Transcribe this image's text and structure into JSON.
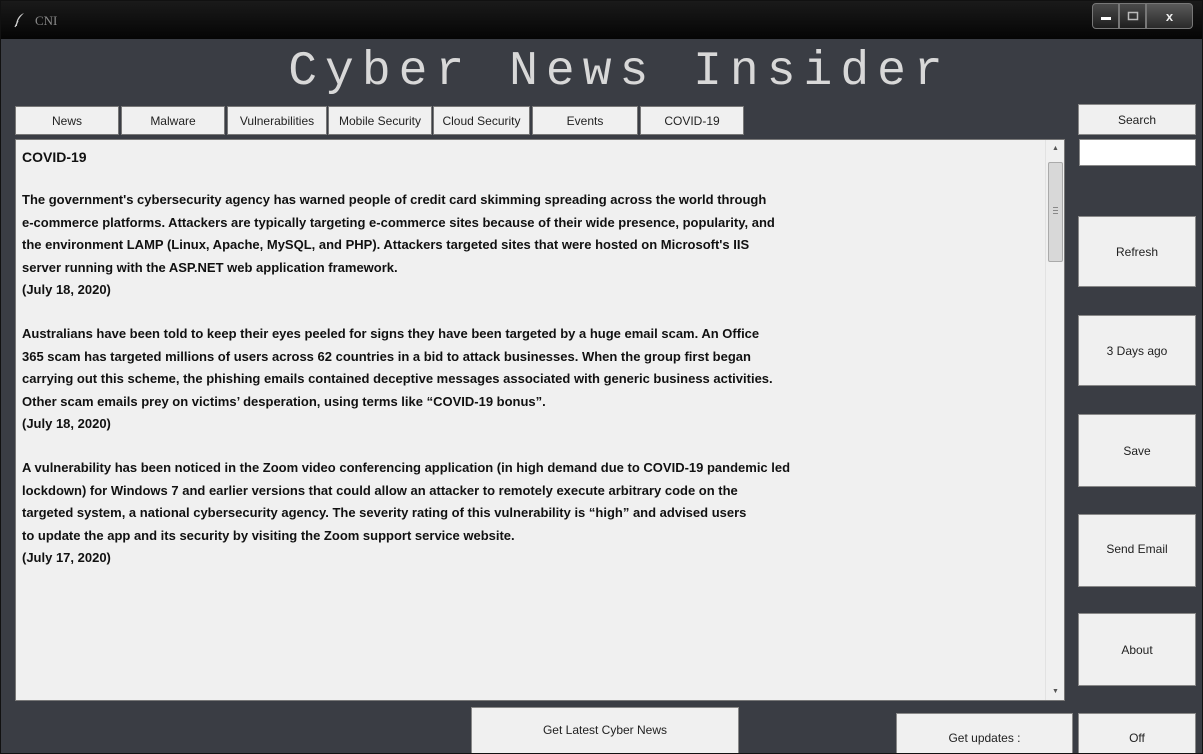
{
  "window": {
    "title": "CNI",
    "icon": "feather-icon",
    "controls": {
      "minimize": "minimize-icon",
      "maximize": "maximize-icon",
      "close_label": "x"
    }
  },
  "app": {
    "title": "Cyber News Insider"
  },
  "tabs": [
    {
      "label": "News"
    },
    {
      "label": "Malware"
    },
    {
      "label": "Vulnerabilities"
    },
    {
      "label": "Mobile Security"
    },
    {
      "label": "Cloud Security"
    },
    {
      "label": "Events"
    },
    {
      "label": "COVID-19"
    }
  ],
  "content": {
    "heading": "COVID-19",
    "articles": [
      {
        "lines": [
          "The government's cybersecurity agency has warned people of credit card skimming spreading across the world through",
          "e-commerce platforms. Attackers are typically targeting e-commerce sites because of their wide presence, popularity, and",
          "the environment LAMP (Linux, Apache, MySQL, and PHP). Attackers targeted sites that were hosted on Microsoft's IIS",
          "server running with the ASP.NET web application framework."
        ],
        "date": "(July 18, 2020)"
      },
      {
        "lines": [
          "Australians have been told to keep their eyes peeled for signs they have been targeted by a huge email scam. An Office",
          "365 scam has targeted millions of users across 62 countries in a bid to attack businesses. When the group first began",
          "carrying out this scheme, the phishing emails contained deceptive messages associated with generic business activities.",
          "Other scam emails prey on victims’ desperation, using terms like “COVID-19 bonus”."
        ],
        "date": "(July 18, 2020)"
      },
      {
        "lines": [
          "A vulnerability has been noticed in the Zoom video conferencing application (in high demand due to COVID-19 pandemic led",
          "lockdown) for Windows 7 and earlier versions that could allow an attacker to remotely execute arbitrary code on the",
          "targeted system, a national cybersecurity agency. The severity rating of this vulnerability is “high” and advised users",
          "to update the app and its security by visiting the Zoom support service website."
        ],
        "date": "(July 17, 2020)"
      }
    ]
  },
  "sidebar": {
    "search_label": "Search",
    "search_value": "",
    "refresh_label": "Refresh",
    "days_ago_label": "3 Days ago",
    "save_label": "Save",
    "send_email_label": "Send Email",
    "about_label": "About"
  },
  "footer": {
    "latest_label": "Get Latest Cyber News",
    "updates_label": "Get updates :",
    "off_label": "Off"
  }
}
